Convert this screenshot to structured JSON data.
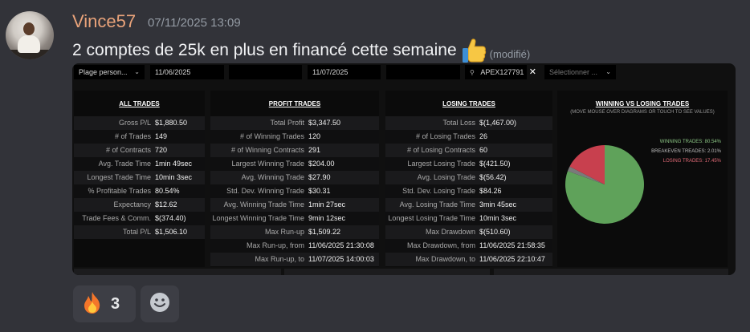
{
  "message": {
    "author": "Vince57",
    "timestamp": "07/11/2025 13:09",
    "text": "2 comptes de 25k en plus en financé cette semaine",
    "emoji_icon": "thumbs-up-icon",
    "edited_label": "(modifié)"
  },
  "filters": {
    "range_select": "Plage person...",
    "date_from": "11/06/2025",
    "date_to": "11/07/2025",
    "account_search": "APEX127791",
    "select_placeholder": "Sélectionner ..."
  },
  "all_trades": {
    "title": "ALL TRADES",
    "rows": [
      {
        "label": "Gross P/L",
        "value": "$1,880.50"
      },
      {
        "label": "# of Trades",
        "value": "149"
      },
      {
        "label": "# of Contracts",
        "value": "720"
      },
      {
        "label": "Avg. Trade Time",
        "value": "1min 49sec"
      },
      {
        "label": "Longest Trade Time",
        "value": "10min 3sec"
      },
      {
        "label": "% Profitable Trades",
        "value": "80.54%"
      },
      {
        "label": "Expectancy",
        "value": "$12.62"
      },
      {
        "label": "Trade Fees & Comm.",
        "value": "$(374.40)"
      },
      {
        "label": "Total P/L",
        "value": "$1,506.10"
      }
    ]
  },
  "profit_trades": {
    "title": "PROFIT TRADES",
    "rows": [
      {
        "label": "Total Profit",
        "value": "$3,347.50"
      },
      {
        "label": "# of Winning Trades",
        "value": "120"
      },
      {
        "label": "# of Winning Contracts",
        "value": "291"
      },
      {
        "label": "Largest Winning Trade",
        "value": "$204.00"
      },
      {
        "label": "Avg. Winning Trade",
        "value": "$27.90"
      },
      {
        "label": "Std. Dev. Winning Trade",
        "value": "$30.31"
      },
      {
        "label": "Avg. Winning Trade Time",
        "value": "1min 27sec"
      },
      {
        "label": "Longest Winning Trade Time",
        "value": "9min 12sec"
      },
      {
        "label": "Max Run-up",
        "value": "$1,509.22"
      },
      {
        "label": "Max Run-up, from",
        "value": "11/06/2025 21:30:08"
      },
      {
        "label": "Max Run-up, to",
        "value": "11/07/2025 14:00:03"
      }
    ]
  },
  "losing_trades": {
    "title": "LOSING TRADES",
    "rows": [
      {
        "label": "Total Loss",
        "value": "$(1,467.00)"
      },
      {
        "label": "# of Losing Trades",
        "value": "26"
      },
      {
        "label": "# of Losing Contracts",
        "value": "60"
      },
      {
        "label": "Largest Losing Trade",
        "value": "$(421.50)"
      },
      {
        "label": "Avg. Losing Trade",
        "value": "$(56.42)"
      },
      {
        "label": "Std. Dev. Losing Trade",
        "value": "$84.26"
      },
      {
        "label": "Avg. Losing Trade Time",
        "value": "3min 45sec"
      },
      {
        "label": "Longest Losing Trade Time",
        "value": "10min 3sec"
      },
      {
        "label": "Max Drawdown",
        "value": "$(510.60)"
      },
      {
        "label": "Max Drawdown, from",
        "value": "11/06/2025 21:58:35"
      },
      {
        "label": "Max Drawdown, to",
        "value": "11/06/2025 22:10:47"
      }
    ]
  },
  "pie": {
    "title": "WINNING VS LOSING TRADES",
    "subtitle": "(MOVE MOUSE OVER DIAGRAMS OR TOUCH TO SEE VALUES)",
    "slices": [
      {
        "label": "WINNING TRADES: 80.54%",
        "value": 80.54,
        "color": "#5fa25a"
      },
      {
        "label": "BREAKEVEN TREADES: 2.01%",
        "value": 2.01,
        "color": "#7a7a7a"
      },
      {
        "label": "LOSING TRADES: 17.45%",
        "value": 17.45,
        "color": "#c8404e"
      }
    ]
  },
  "reactions": [
    {
      "emoji": "fire-icon",
      "count": "3"
    },
    {
      "emoji": "add-reaction-icon"
    }
  ]
}
